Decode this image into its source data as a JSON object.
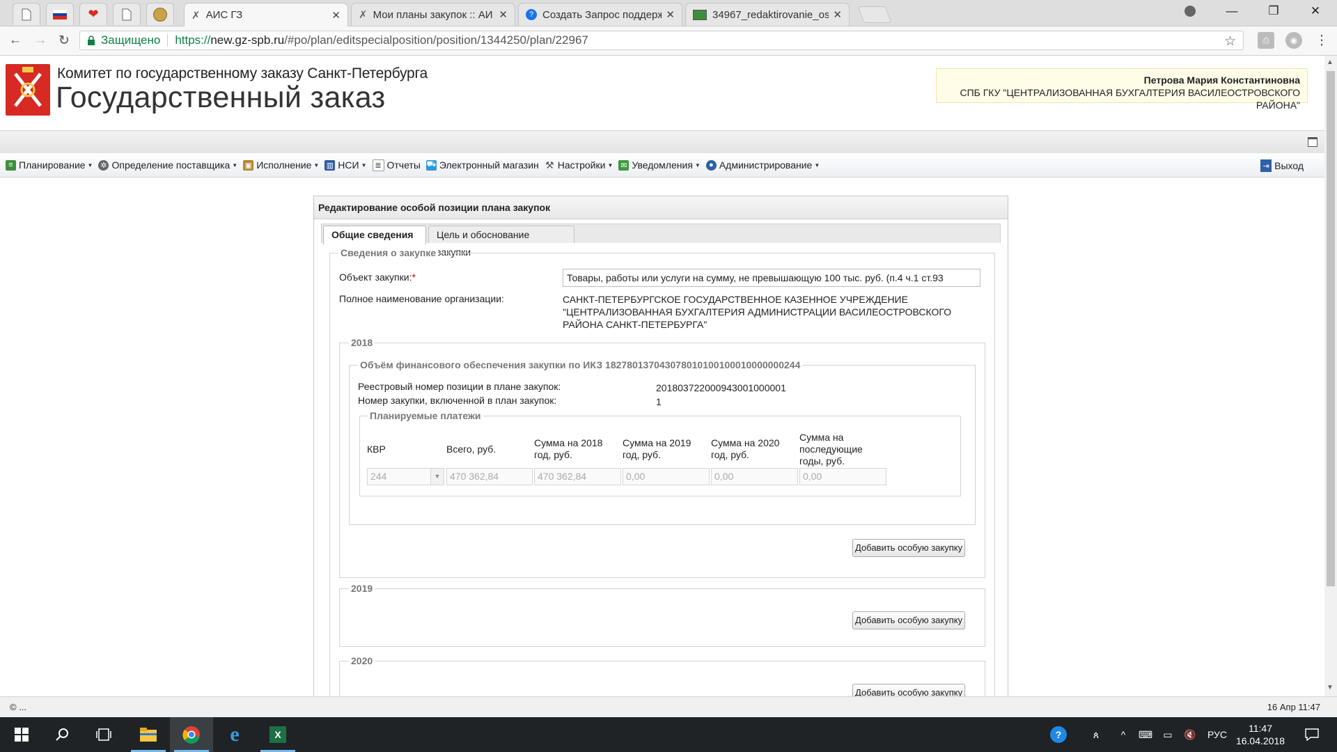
{
  "browser": {
    "tabs": [
      {
        "title": "АИС ГЗ",
        "active": true
      },
      {
        "title": "Мои планы закупок :: АИ",
        "active": false
      },
      {
        "title": "Создать Запрос поддерж",
        "active": false
      },
      {
        "title": "34967_redaktirovanie_os",
        "active": false
      }
    ],
    "secure_label": "Защищено",
    "url_scheme": "https://",
    "url_host": "new.gz-spb.ru",
    "url_path": "/#po/plan/editspecialposition/position/1344250/plan/22967"
  },
  "header": {
    "org_line": "Комитет по государственному заказу Санкт-Петербурга",
    "brand": "Государственный заказ",
    "user_name": "Петрова Мария Константиновна",
    "user_org": "СПБ ГКУ \"ЦЕНТРАЛИЗОВАННАЯ БУХГАЛТЕРИЯ ВАСИЛЕОСТРОВСКОГО РАЙОНА\""
  },
  "menu": {
    "items": [
      {
        "label": "Планирование",
        "dropdown": true
      },
      {
        "label": "Определение поставщика",
        "dropdown": true
      },
      {
        "label": "Исполнение",
        "dropdown": true
      },
      {
        "label": "НСИ",
        "dropdown": true
      },
      {
        "label": "Отчеты",
        "dropdown": false
      },
      {
        "label": "Электронный магазин",
        "dropdown": false
      },
      {
        "label": "Настройки",
        "dropdown": true
      },
      {
        "label": "Уведомления",
        "dropdown": true
      },
      {
        "label": "Администрирование",
        "dropdown": true
      }
    ],
    "exit": "Выход"
  },
  "form": {
    "title": "Редактирование особой позиции плана закупок",
    "tabs": [
      "Общие сведения",
      "Цель и обоснование закупки"
    ],
    "section_title": "Сведения о закупке",
    "object_label": "Объект закупки:",
    "required_mark": "*",
    "object_value": "Товары, работы или услуги на сумму, не превышающую 100 тыс. руб. (п.4 ч.1 ст.93",
    "org_full_label": "Полное наименование организации:",
    "org_full_lines": [
      "САНКТ-ПЕТЕРБУРГСКОЕ ГОСУДАРСТВЕННОЕ КАЗЕННОЕ УЧРЕЖДЕНИЕ",
      "\"ЦЕНТРАЛИЗОВАННАЯ БУХГАЛТЕРИЯ АДМИНИСТРАЦИИ ВАСИЛЕОСТРОВСКОГО",
      "РАЙОНА САНКТ-ПЕТЕРБУРГА\""
    ],
    "year_2018": {
      "legend": "2018",
      "finance_legend": "Объём финансового обеспечения закупки по ИКЗ 182780137043078010100100010000000244",
      "registry_label": "Реестровый номер позиции в плане закупок:",
      "registry_value": "201803722000943001000001",
      "purchase_num_label": "Номер закупки, включенной в план закупок:",
      "purchase_num_value": "1",
      "payments_legend": "Планируемые платежи",
      "columns": [
        "КВР",
        "Всего, руб.",
        "Сумма на 2018 год, руб.",
        "Сумма на 2019 год, руб.",
        "Сумма на 2020 год, руб.",
        "Сумма на последующие годы, руб."
      ],
      "row": {
        "kvr": "244",
        "total": "470 362,84",
        "sum_2018": "470 362,84",
        "sum_2019": "0,00",
        "sum_2020": "0,00",
        "sum_later": "0,00"
      },
      "add_button": "Добавить особую закупку"
    },
    "year_2019": {
      "legend": "2019",
      "add_button": "Добавить особую закупку"
    },
    "year_2020": {
      "legend": "2020",
      "add_button": "Добавить особую закупку"
    }
  },
  "statusbar": {
    "left": "© ...",
    "right": "16 Апр 11:47"
  },
  "taskbar": {
    "lang": "РУС",
    "time": "11:47",
    "date": "16.04.2018"
  }
}
